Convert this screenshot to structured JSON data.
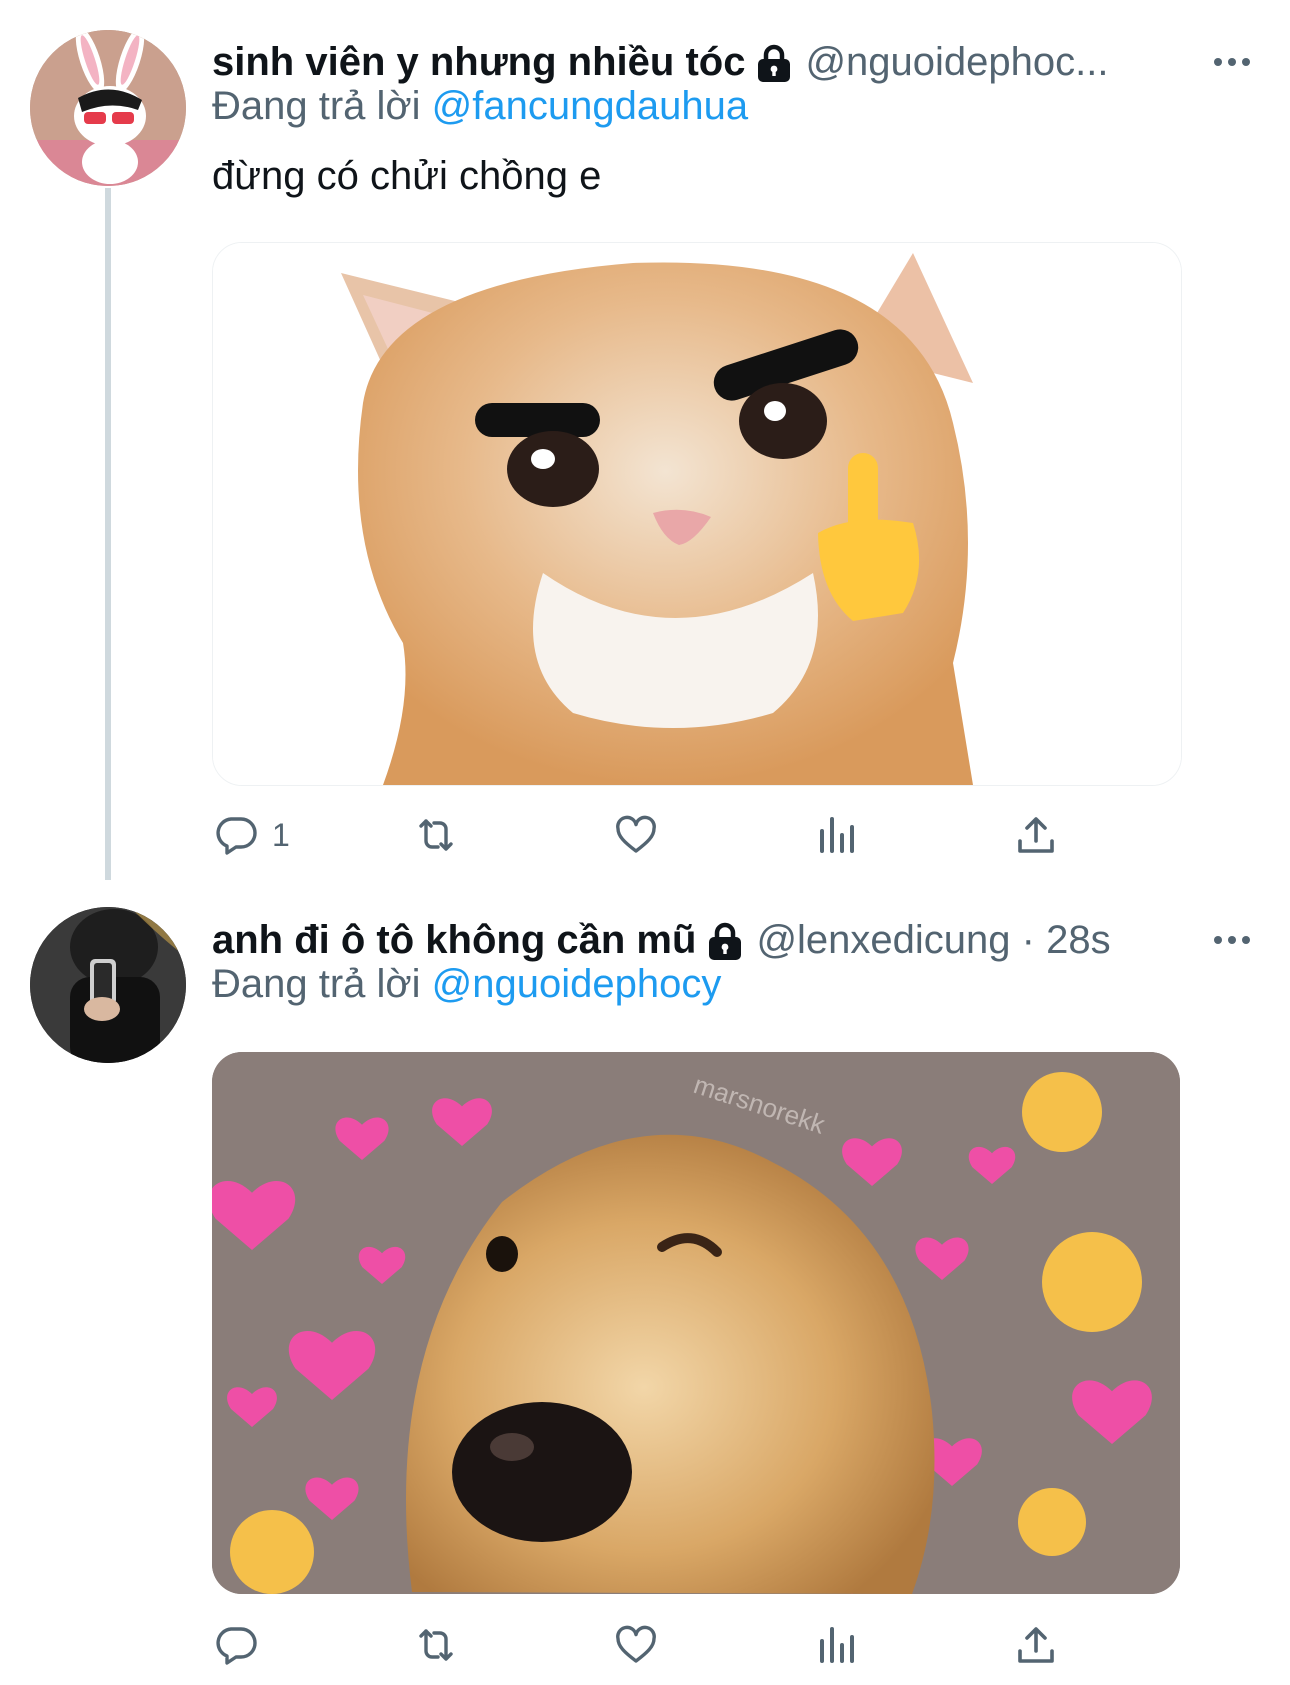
{
  "tweets": [
    {
      "display_name": "sinh viên y nhưng nhiều tóc",
      "handle": "@nguoidephoc...",
      "replying_prefix": "Đang trả lời",
      "replying_to": "@fancungdauhua",
      "text": "đừng có chửi chồng e",
      "media": "cat-middle-finger-meme",
      "actions": {
        "reply_count": "1",
        "retweet_count": "",
        "like_count": ""
      }
    },
    {
      "display_name": "anh đi ô tô không cần mũ",
      "handle": "@lenxedicung · 28s",
      "replying_prefix": "Đang trả lời",
      "replying_to": "@nguoidephocy",
      "media": "dog-wink-hearts-meme",
      "media_watermark": "marsnorekk",
      "actions": {
        "reply_count": "",
        "retweet_count": "",
        "like_count": ""
      }
    }
  ],
  "icons": {
    "lock": "lock-icon",
    "more": "more-icon",
    "reply": "reply-icon",
    "retweet": "retweet-icon",
    "like": "heart-icon",
    "views": "views-icon",
    "share": "share-icon"
  },
  "colors": {
    "text_primary": "#0f1419",
    "text_secondary": "#536471",
    "link": "#1d9bf0",
    "thread_line": "#cfd9de"
  }
}
